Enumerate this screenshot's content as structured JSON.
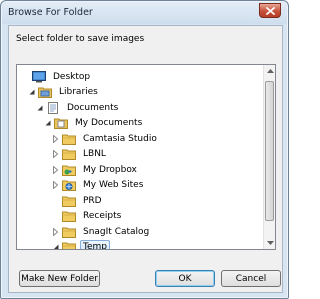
{
  "window": {
    "title": "Browse For Folder",
    "close_icon": "close-icon"
  },
  "instruction": "Select folder to save images",
  "tree": {
    "items": [
      {
        "label": "Desktop",
        "level": 0,
        "expander": "none",
        "icon": "desktop-icon"
      },
      {
        "label": "Libraries",
        "level": 1,
        "expander": "expanded",
        "icon": "libraries-icon"
      },
      {
        "label": "Documents",
        "level": 2,
        "expander": "expanded",
        "icon": "documents-library-icon"
      },
      {
        "label": "My Documents",
        "level": 3,
        "expander": "expanded",
        "icon": "document-folder-icon"
      },
      {
        "label": "Camtasia Studio",
        "level": 4,
        "expander": "collapsed",
        "icon": "folder-icon"
      },
      {
        "label": "LBNL",
        "level": 4,
        "expander": "collapsed",
        "icon": "folder-icon"
      },
      {
        "label": "My Dropbox",
        "level": 4,
        "expander": "collapsed",
        "icon": "dropbox-folder-icon"
      },
      {
        "label": "My Web Sites",
        "level": 4,
        "expander": "collapsed",
        "icon": "web-folder-icon"
      },
      {
        "label": "PRD",
        "level": 4,
        "expander": "none",
        "icon": "folder-icon"
      },
      {
        "label": "Receipts",
        "level": 4,
        "expander": "none",
        "icon": "folder-icon"
      },
      {
        "label": "SnagIt Catalog",
        "level": 4,
        "expander": "collapsed",
        "icon": "folder-icon"
      },
      {
        "label": "Temp",
        "level": 4,
        "expander": "expanded",
        "icon": "folder-icon",
        "selected": true
      }
    ]
  },
  "buttons": {
    "new_folder": "Make New Folder",
    "ok": "OK",
    "cancel": "Cancel"
  },
  "colors": {
    "frame": "#d7e4f2",
    "close": "#c6513b",
    "folder": "#e8c25a",
    "selection": "#cfe6fb"
  }
}
